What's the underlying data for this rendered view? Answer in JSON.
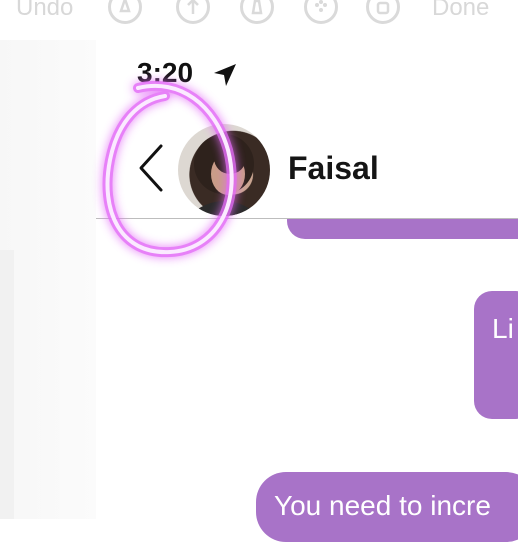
{
  "markup_toolbar": {
    "undo_label": "Undo",
    "done_label": "Done",
    "tools": [
      "pen-tool",
      "marker-tool",
      "highlighter-tool",
      "color-palette",
      "eraser-tool"
    ]
  },
  "status_bar": {
    "time": "3:20",
    "location_icon": "location-arrow-icon"
  },
  "header": {
    "back_icon": "chevron-left-icon",
    "contact_name": "Faisal"
  },
  "messages": [
    {
      "text": "",
      "from": "me"
    },
    {
      "text": "Li",
      "from": "me"
    },
    {
      "text": "You need to incre",
      "from": "me"
    }
  ],
  "colors": {
    "bubble": "#a873c8",
    "annotation": "#e879ff"
  }
}
